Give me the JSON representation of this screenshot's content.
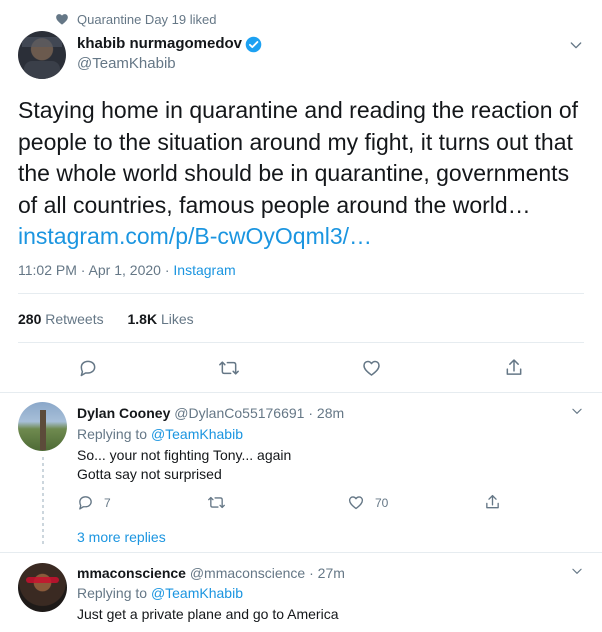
{
  "social_context": "Quarantine Day 19 liked",
  "main_tweet": {
    "author_name": "khabib nurmagomedov",
    "handle": "@TeamKhabib",
    "text": "Staying home in quarantine and reading the reaction of people to the situation around my fight, it turns out that the whole world should be in quarantine, governments of all countries, famous people around the world…",
    "link": "instagram.com/p/B-cwOyOqml3/…",
    "time": "11:02 PM · Apr 1, 2020",
    "separator": "·",
    "source": "Instagram",
    "retweets_count": "280",
    "retweets_label": "Retweets",
    "likes_count": "1.8K",
    "likes_label": "Likes"
  },
  "replies": [
    {
      "author_name": "Dylan Cooney",
      "handle": "@DylanCo55176691",
      "separator": "·",
      "time": "28m",
      "replying_label": "Replying to",
      "replying_to": "@TeamKhabib",
      "text_line1": "So... your not fighting Tony... again",
      "text_line2": "Gotta say not surprised",
      "reply_count": "7",
      "like_count": "70",
      "more_replies": "3 more replies"
    },
    {
      "author_name": "mmaconscience",
      "handle": "@mmaconscience",
      "separator": "·",
      "time": "27m",
      "replying_label": "Replying to",
      "replying_to": "@TeamKhabib",
      "text_line1": "Just get a private plane and go to America"
    }
  ],
  "colors": {
    "link": "#1b95e0",
    "muted": "#657786",
    "divider": "#e6ecf0",
    "verified": "#1da1f2"
  },
  "icons": [
    "heart-icon",
    "verified-badge-icon",
    "chevron-down-icon",
    "reply-icon",
    "retweet-icon",
    "like-icon",
    "share-icon"
  ]
}
